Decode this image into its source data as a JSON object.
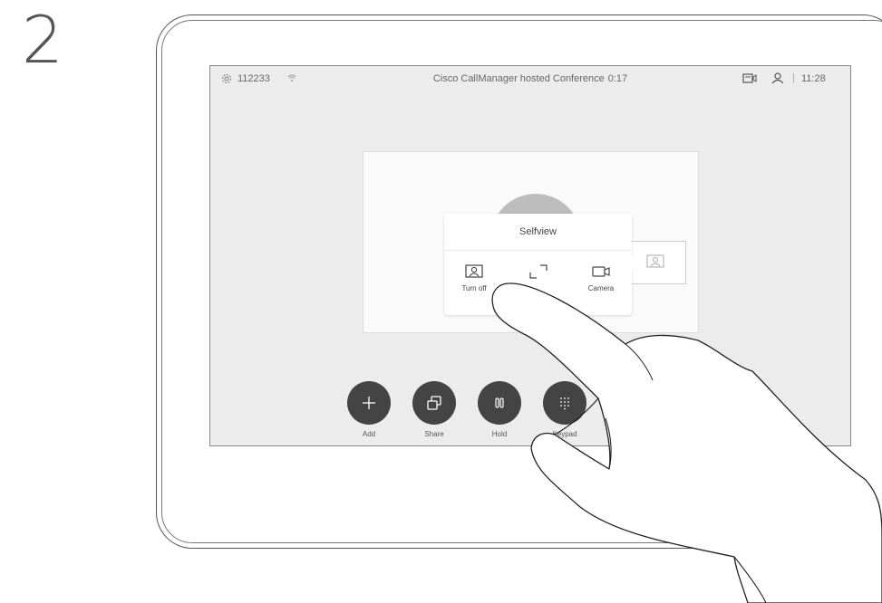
{
  "step_number": "2",
  "status_bar": {
    "icon_settings": "gear-icon",
    "number": "112233",
    "icon_network": "wifi-icon",
    "title": "Cisco CallManager hosted Conference",
    "timer": "0:17",
    "icon_video": "video-layout-icon",
    "icon_user": "user-icon",
    "separator": "|",
    "time": "11:28"
  },
  "popup": {
    "title": "Selfview",
    "options": [
      {
        "label": "Turn off",
        "icon": "selfview-person-icon"
      },
      {
        "label": "",
        "icon": "fullscreen-icon"
      },
      {
        "label": "Camera",
        "icon": "camera-icon"
      }
    ]
  },
  "controls": [
    {
      "label": "Add",
      "icon": "plus-icon"
    },
    {
      "label": "Share",
      "icon": "share-icon"
    },
    {
      "label": "Hold",
      "icon": "pause-icon"
    },
    {
      "label": "Keypad",
      "icon": "keypad-icon"
    }
  ],
  "colors": {
    "screen_bg": "#ececec",
    "button_bg": "#444444",
    "popup_bg": "#ffffff",
    "avatar": "#bdbdbd"
  }
}
